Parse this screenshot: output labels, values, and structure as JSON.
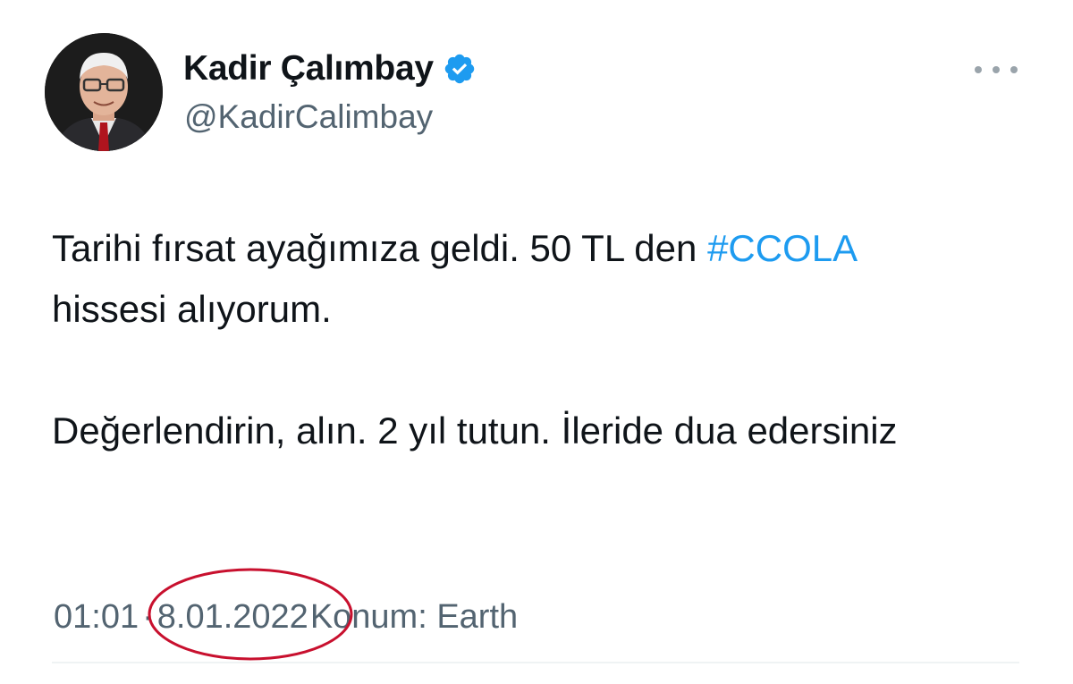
{
  "author": {
    "name": "Kadir Çalımbay",
    "handle": "@KadirCalimbay",
    "verified": true,
    "verified_color": "#1d9bf0"
  },
  "tweet": {
    "line1_text": "Tarihi fırsat ayağımıza geldi. 50 TL den ",
    "hashtag": "#CCOLA",
    "line1_rest": "hissesi alıyorum.",
    "para2": "Değerlendirin, alın. 2 yıl tutun. İleride dua edersiniz"
  },
  "meta": {
    "time": "01:01",
    "separator": "·",
    "date": "8.01.2022",
    "location": "Konum: Earth"
  },
  "annotation": {
    "circle_color": "#c8102e"
  },
  "icons": {
    "more": "more-options-icon",
    "verified": "verified-badge-icon"
  },
  "colors": {
    "text": "#0f1419",
    "secondary": "#536471",
    "link": "#1d9bf0"
  }
}
